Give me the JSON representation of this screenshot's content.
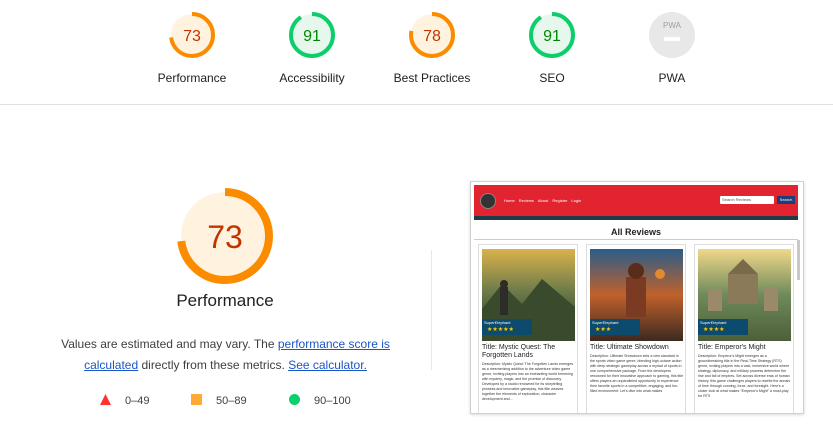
{
  "gauges": [
    {
      "label": "Performance",
      "score": "73",
      "value": 73,
      "color": "#fb8c00",
      "text_color": "#c33300",
      "bg": "#fff3e0"
    },
    {
      "label": "Accessibility",
      "score": "91",
      "value": 91,
      "color": "#0cce6b",
      "text_color": "#008800",
      "bg": "#e6f8ee"
    },
    {
      "label": "Best Practices",
      "score": "78",
      "value": 78,
      "color": "#fb8c00",
      "text_color": "#c33300",
      "bg": "#fff3e0"
    },
    {
      "label": "SEO",
      "score": "91",
      "value": 91,
      "color": "#0cce6b",
      "text_color": "#008800",
      "bg": "#e6f8ee"
    },
    {
      "label": "PWA",
      "badge": "PWA",
      "value": 0,
      "color": "#bdbdbd",
      "bg": "#e8e8e8"
    }
  ],
  "main": {
    "score": "73",
    "value": 73,
    "title": "Performance",
    "desc_1": "Values are estimated and may vary. The ",
    "link_1": "performance score is calculated",
    "desc_2": " directly from these metrics. ",
    "link_2": "See calculator.",
    "legend": [
      {
        "range": "0–49",
        "color": "#ff3333",
        "shape": "triangle"
      },
      {
        "range": "50–89",
        "color": "#ffaa33",
        "shape": "square"
      },
      {
        "range": "90–100",
        "color": "#0cce6b",
        "shape": "circle"
      }
    ]
  },
  "screenshot": {
    "nav_links": [
      "Home",
      "Reviews",
      "About",
      "Register",
      "Login"
    ],
    "search_placeholder": "Search Reviews",
    "search_button": "Search",
    "heading": "All Reviews",
    "cards": [
      {
        "title": "Title: Mystic Quest: The Forgotten Lands",
        "user": "SuperElephant",
        "stars": "★★★★★",
        "description": "Description: Mystic Quest: The Forgotten Lands emerges as a mesmerizing addition to the adventure video game genre, inviting players into an enchanting world brimming with mystery, magic, and the promise of discovery. Developed by a studio renowned for its storytelling prowess and innovative gameplay, this title weaves together the elements of exploration, character development and..."
      },
      {
        "title": "Title: Ultimate Showdown",
        "user": "SuperElephant",
        "stars": "★★★",
        "description": "Description: Ultimate Showdown sets a new standard in the sports video game genre, blending high-octane action with deep strategic gameplay across a myriad of sports in one comprehensive package. From the developers renowned for their innovative approach to gaming, this title offers players an unparalleled opportunity to experience their favorite sports in a competitive, engaging, and fun-filled environment. Let's dive into what makes"
      },
      {
        "title": "Title: Emperor's Might",
        "user": "SuperElephant",
        "stars": "★★★★",
        "description": "Description: Emperor's Might emerges as a groundbreaking title in the Real-Time Strategy (RTS) genre, inviting players into a vast, immersive world where strategy, diplomacy, and military prowess determine the rise and fall of empires. Set across diverse eras of human history, this game challenges players to rewrite the annals of time through cunning, force, and foresight. Here's a closer look at what makes \"Emperor's Might\" a must-play for RTS"
      }
    ]
  }
}
